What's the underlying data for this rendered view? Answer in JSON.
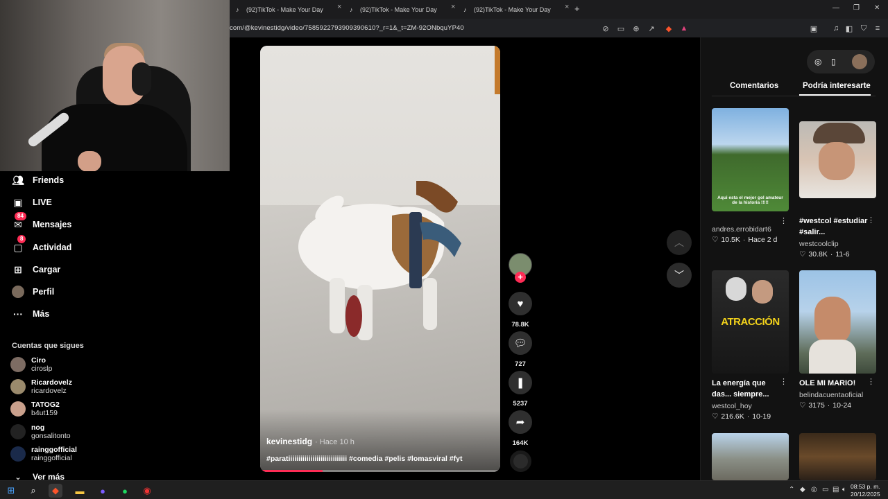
{
  "browser": {
    "tabs": [
      {
        "label": "(92)TikTok - Make Your Day"
      },
      {
        "label": "(92)TikTok - Make Your Day"
      },
      {
        "label": "(92)TikTok - Make Your Day"
      }
    ],
    "url": "com/@kevinestidg/video/7585922793909390610?_r=1&_t=ZM-92ONbquYP40"
  },
  "sidebar": {
    "items": [
      {
        "label": "Friends",
        "icon": "friends-icon"
      },
      {
        "label": "LIVE",
        "icon": "live-icon"
      },
      {
        "label": "Mensajes",
        "icon": "messages-icon",
        "badge": "84"
      },
      {
        "label": "Actividad",
        "icon": "activity-icon",
        "badge": "8"
      },
      {
        "label": "Cargar",
        "icon": "upload-icon"
      },
      {
        "label": "Perfil",
        "icon": "profile-avatar"
      },
      {
        "label": "Más",
        "icon": "more-icon"
      }
    ],
    "following_title": "Cuentas que sigues",
    "following": [
      {
        "name": "Ciro",
        "handle": "ciroslp"
      },
      {
        "name": "Ricardovelz",
        "handle": "ricardovelz"
      },
      {
        "name": "TATOG2",
        "handle": "b4ut159"
      },
      {
        "name": "nog",
        "handle": "gonsalitonto"
      },
      {
        "name": "rainggofficial",
        "handle": "rainggofficial"
      }
    ],
    "see_more": "Ver más"
  },
  "video": {
    "author": "kevinestidg",
    "time": "· Hace 10 h",
    "caption": "#paratiiiiiiiiiiiiiiiiiiiiiiiiiiiii #comedia #pelis #lomasviral #fyt",
    "progress": 0.26
  },
  "actions": {
    "likes": "78.8K",
    "comments": "727",
    "saves": "5237",
    "shares": "164K"
  },
  "right_panel": {
    "tabs": [
      "Comentarios",
      "Podría interesarte"
    ],
    "active_tab": 1,
    "cards": [
      {
        "title": "",
        "author": "andres.errobidart6",
        "likes": "10.5K",
        "date": "Hace 2 d",
        "thumb_text": "Aqui esta el mejor gol amateur de la historia !!!!!"
      },
      {
        "title": "#westcol #estudiar #salir...",
        "author": "westcoolclip",
        "likes": "30.8K",
        "date": "11-6",
        "thumb_text": ""
      },
      {
        "title": "La energía que das... siempre...",
        "author": "westcol_hoy",
        "likes": "216.6K",
        "date": "10-19",
        "thumb_text": "ATRACCIÓN"
      },
      {
        "title": "OLE MI MARIO!",
        "author": "belindacuentaoficial",
        "likes": "3175",
        "date": "10-24",
        "thumb_text": ""
      }
    ]
  },
  "taskbar": {
    "time": "08:53 p. m.",
    "date": "20/12/2025"
  },
  "colors": {
    "accent": "#fe2c55",
    "background": "#000000",
    "panel": "#121212"
  }
}
